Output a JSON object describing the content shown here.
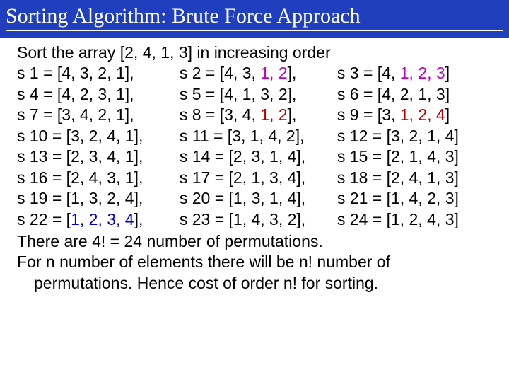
{
  "title": "Sorting Algorithm: Brute Force Approach",
  "intro": "Sort the array [2, 4, 1, 3] in increasing order",
  "rows": [
    {
      "a": "s 1 = [4, 3, 2, 1],",
      "b": "s 2 = [4, 3, ",
      "b2": "1, 2",
      "b3": "],",
      "c": "s 3 = [4, ",
      "c2": "1, 2, 3",
      "c3": "]"
    },
    {
      "a": "s 4 = [4, 2, 3, 1],",
      "b": "s 5 = [4, 1, 3, 2],",
      "c": "s 6 = [4, 2, 1, 3]"
    },
    {
      "a": "s 7 = [3, 4, 2, 1],",
      "b": "s 8 = [3, 4, ",
      "b2": "1, 2",
      "b3": "],",
      "c": "s 9 = [3, ",
      "c2": "1, 2, 4",
      "c3": "]"
    },
    {
      "a": "s 10 = [3, 2, 4, 1],",
      "b": "s 11 = [3, 1, 4, 2],",
      "c": "s 12 = [3, 2, 1, 4]"
    },
    {
      "a": "s 13 = [2, 3, 4, 1],",
      "b": "s 14 = [2, 3, 1, 4],",
      "c": "s 15 = [2, 1, 4, 3]"
    },
    {
      "a": "s 16 = [2, 4, 3, 1],",
      "b": "s 17 = [2, 1, 3, 4],",
      "c": "s 18 = [2, 4, 1, 3]"
    },
    {
      "a": "s 19 = [1, 3, 2, 4],",
      "b": "s 20 = [1, 3, 1, 4],",
      "c": "s 21 = [1, 4, 2, 3]"
    },
    {
      "a": "s 22 = [",
      "a2": "1, 2, 3, 4",
      "a3": "],",
      "b": "s 23 = [1, 4, 3, 2],",
      "c": "s 24 = [1, 2, 4, 3]"
    }
  ],
  "footer1": "There are 4! = 24 number of permutations.",
  "footer2a": "For n number of elements there will be n! number of",
  "footer2b": "permutations. Hence cost of order n! for sorting."
}
